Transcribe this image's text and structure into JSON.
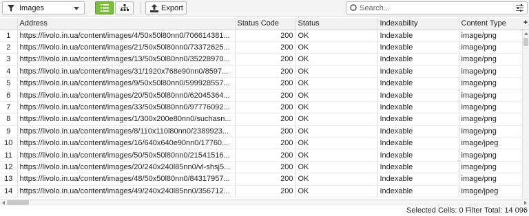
{
  "toolbar": {
    "filter_value": "Images",
    "export_label": "Export",
    "search_placeholder": "Search..."
  },
  "table": {
    "columns": [
      "Address",
      "Status Code",
      "Status",
      "Indexability",
      "Content Type"
    ],
    "rows": [
      {
        "index": "1",
        "address": "https://livolo.in.ua/content/images/4/50x50l80nn0/706614381...",
        "status_code": "200",
        "status": "OK",
        "indexability": "Indexable",
        "content_type": "image/png"
      },
      {
        "index": "2",
        "address": "https://livolo.in.ua/content/images/21/50x50l80nn0/73372625...",
        "status_code": "200",
        "status": "OK",
        "indexability": "Indexable",
        "content_type": "image/png"
      },
      {
        "index": "3",
        "address": "https://livolo.in.ua/content/images/13/50x50l80nn0/35228970...",
        "status_code": "200",
        "status": "OK",
        "indexability": "Indexable",
        "content_type": "image/png"
      },
      {
        "index": "4",
        "address": "https://livolo.in.ua/content/images/31/1920x768e90nn0/8597...",
        "status_code": "200",
        "status": "OK",
        "indexability": "Indexable",
        "content_type": "image/png"
      },
      {
        "index": "5",
        "address": "https://livolo.in.ua/content/images/9/50x50l80nn0/599928557...",
        "status_code": "200",
        "status": "OK",
        "indexability": "Indexable",
        "content_type": "image/png"
      },
      {
        "index": "6",
        "address": "https://livolo.in.ua/content/images/20/50x50l80nn0/62045364...",
        "status_code": "200",
        "status": "OK",
        "indexability": "Indexable",
        "content_type": "image/png"
      },
      {
        "index": "7",
        "address": "https://livolo.in.ua/content/images/33/50x50l80nn0/97776092...",
        "status_code": "200",
        "status": "OK",
        "indexability": "Indexable",
        "content_type": "image/png"
      },
      {
        "index": "8",
        "address": "https://livolo.in.ua/content/images/1/300x200e80nn0/suchasn...",
        "status_code": "200",
        "status": "OK",
        "indexability": "Indexable",
        "content_type": "image/png"
      },
      {
        "index": "9",
        "address": "https://livolo.in.ua/content/images/8/110x110l80nn0/2389923...",
        "status_code": "200",
        "status": "OK",
        "indexability": "Indexable",
        "content_type": "image/png"
      },
      {
        "index": "10",
        "address": "https://livolo.in.ua/content/images/16/640x640e90nn0/17760...",
        "status_code": "200",
        "status": "OK",
        "indexability": "Indexable",
        "content_type": "image/jpeg"
      },
      {
        "index": "11",
        "address": "https://livolo.in.ua/content/images/50/50x50l80nn0/21541516...",
        "status_code": "200",
        "status": "OK",
        "indexability": "Indexable",
        "content_type": "image/png"
      },
      {
        "index": "12",
        "address": "https://livolo.in.ua/content/images/20/240x240l85nn0/vl-shsj5...",
        "status_code": "200",
        "status": "OK",
        "indexability": "Indexable",
        "content_type": "image/png"
      },
      {
        "index": "13",
        "address": "https://livolo.in.ua/content/images/48/50x50l80nn0/84317957...",
        "status_code": "200",
        "status": "OK",
        "indexability": "Indexable",
        "content_type": "image/png"
      },
      {
        "index": "14",
        "address": "https://livolo.in.ua/content/images/49/240x240l85nn0/356712...",
        "status_code": "200",
        "status": "OK",
        "indexability": "Indexable",
        "content_type": "image/jpeg"
      }
    ]
  },
  "add_column_label": "+",
  "status_bar": {
    "text": "Selected Cells: 0  Filter Total: 14 096"
  },
  "icons": {
    "filter": "funnel-icon",
    "list_view": "list-view-icon",
    "tree_view": "tree-view-icon",
    "export": "export-icon",
    "search": "search-icon",
    "advanced": "sliders-icon"
  },
  "colors": {
    "active_view": "#7cbd3b"
  }
}
